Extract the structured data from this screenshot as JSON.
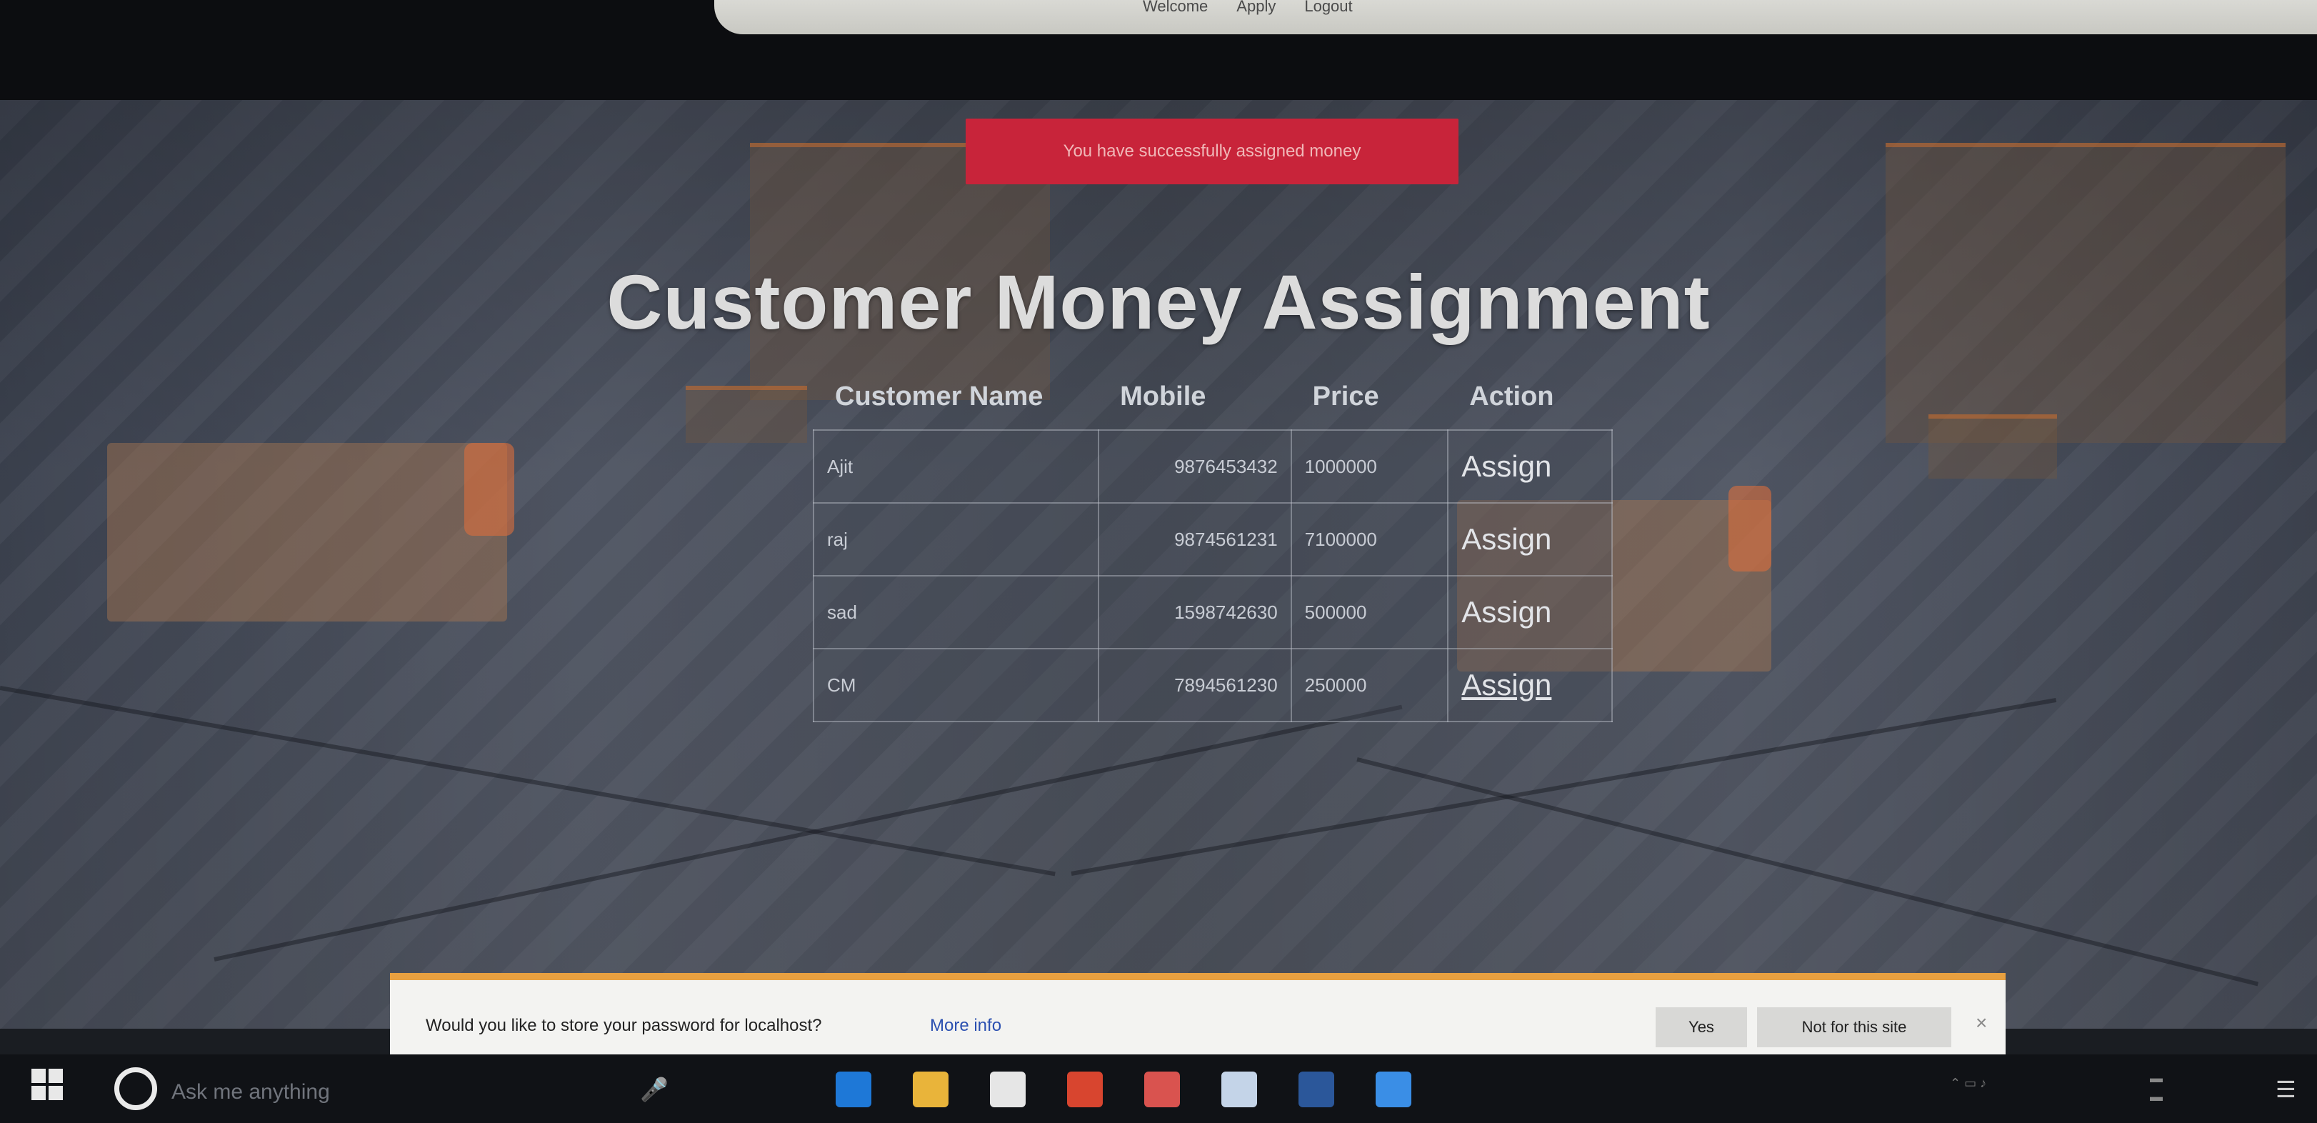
{
  "nav": {
    "links": [
      "Welcome",
      "Apply",
      "Logout"
    ]
  },
  "alert": {
    "message": "You have successfully assigned money"
  },
  "page_title": "Customer Money Assignment",
  "table": {
    "headers": [
      "Customer Name",
      "Mobile",
      "Price",
      "Action"
    ],
    "rows": [
      {
        "name": "Ajit",
        "mobile": "9876453432",
        "price": "1000000",
        "action": "Assign"
      },
      {
        "name": "raj",
        "mobile": "9874561231",
        "price": "7100000",
        "action": "Assign"
      },
      {
        "name": "sad",
        "mobile": "1598742630",
        "price": "500000",
        "action": "Assign"
      },
      {
        "name": "CM",
        "mobile": "7894561230",
        "price": "250000",
        "action": "Assign"
      }
    ]
  },
  "password_bar": {
    "message": "Would you like to store your password for localhost?",
    "more_info": "More info",
    "yes": "Yes",
    "not_for_site": "Not for this site",
    "close": "×"
  },
  "taskbar": {
    "search_placeholder": "Ask me anything",
    "apps": [
      {
        "name": "edge-icon",
        "color": "#1e78d7"
      },
      {
        "name": "file-explorer-icon",
        "color": "#e9b43a"
      },
      {
        "name": "store-icon",
        "color": "#e6e6e6"
      },
      {
        "name": "chrome-icon",
        "color": "#d8452f"
      },
      {
        "name": "app-icon",
        "color": "#d9534f"
      },
      {
        "name": "box-icon",
        "color": "#c4d4e8"
      },
      {
        "name": "word-icon",
        "color": "#2b579a"
      },
      {
        "name": "ie-icon",
        "color": "#3a8ee6"
      }
    ]
  }
}
